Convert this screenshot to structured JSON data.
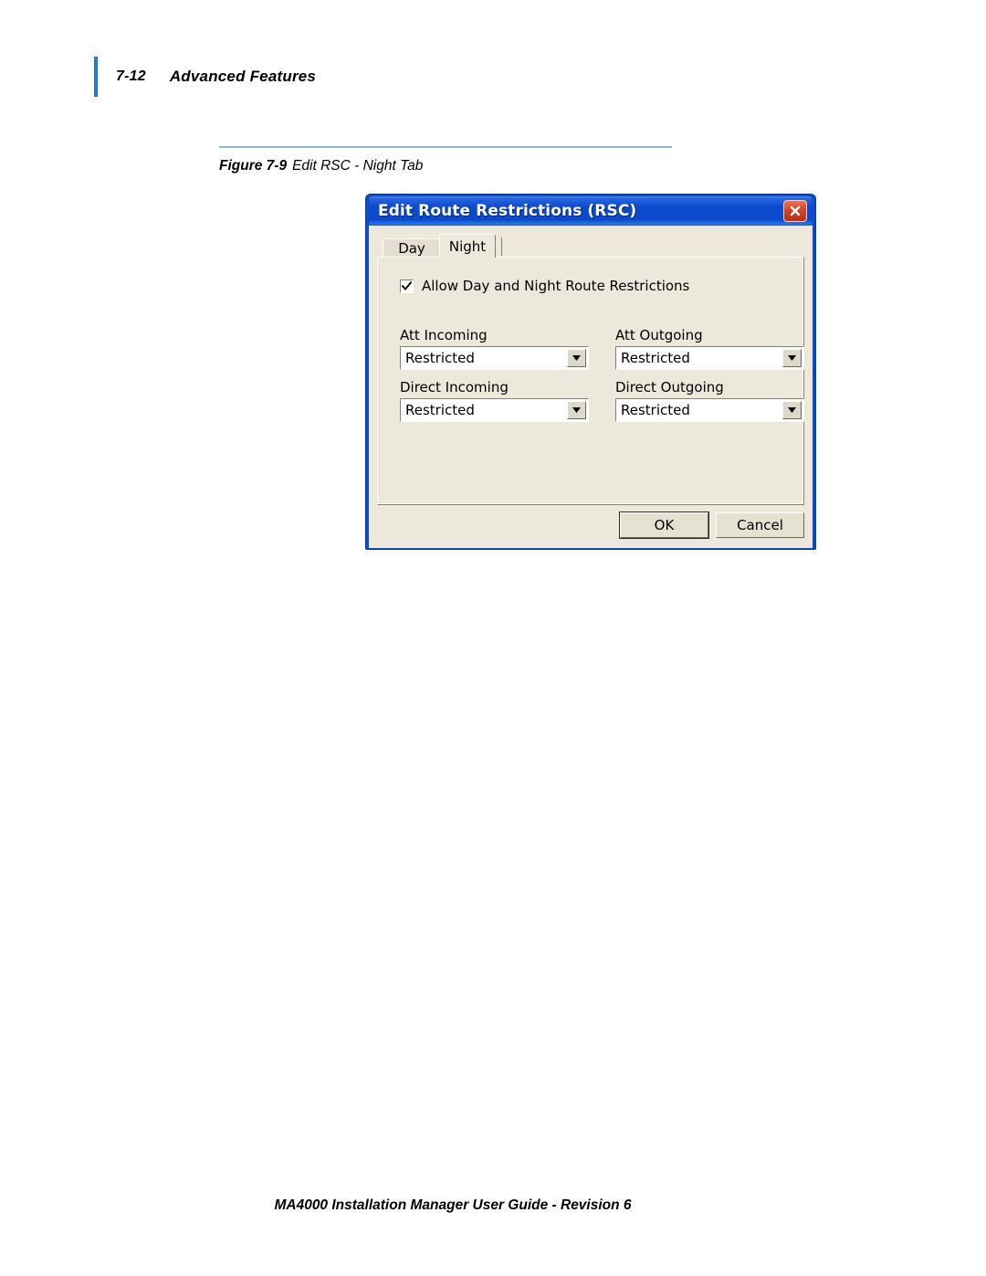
{
  "header": {
    "folio": "7-12",
    "chapter_title": "Advanced Features",
    "rule_color": "#2277dd"
  },
  "figure": {
    "rule_color": "#8fb8d8",
    "caption_label": "Figure 7-9",
    "caption_title": "Edit RSC - Night Tab"
  },
  "dialog": {
    "title": "Edit Route Restrictions (RSC)",
    "close_icon": "close-x-icon",
    "titlebar_color": "#0b49cd",
    "body_color": "#ece9dc",
    "tabs": [
      {
        "label": "Day",
        "active": false
      },
      {
        "label": "Night",
        "active": true
      }
    ],
    "checkbox": {
      "label": "Allow Day and Night Route Restrictions",
      "checked": true,
      "icon": "checkmark-icon"
    },
    "fields": [
      {
        "label": "Att Incoming",
        "value": "Restricted"
      },
      {
        "label": "Att Outgoing",
        "value": "Restricted"
      },
      {
        "label": "Direct Incoming",
        "value": "Restricted"
      },
      {
        "label": "Direct Outgoing",
        "value": "Restricted"
      }
    ],
    "dropdown_icon": "chevron-down-icon",
    "buttons": {
      "ok": "OK",
      "cancel": "Cancel"
    }
  },
  "footer": {
    "text": "MA4000 Installation Manager User Guide - Revision 6"
  }
}
